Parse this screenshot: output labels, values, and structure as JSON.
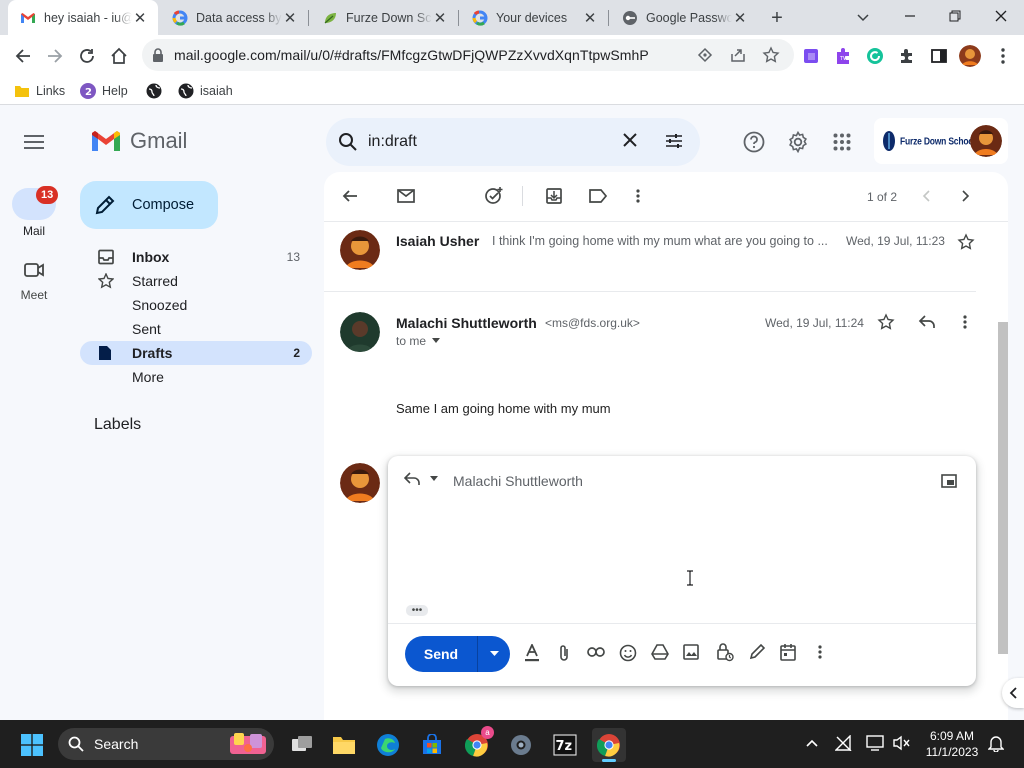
{
  "browser": {
    "tabs": [
      {
        "title": "hey isaiah - iu@"
      },
      {
        "title": "Data access by"
      },
      {
        "title": "Furze Down Sc"
      },
      {
        "title": "Your devices"
      },
      {
        "title": "Google Passwo"
      }
    ],
    "url": "mail.google.com/mail/u/0/#drafts/FMfcgzGtwDFjQWPZzXvvdXqnTtpwSmhP",
    "bookmarks": [
      {
        "label": "Links"
      },
      {
        "label": "Help"
      },
      {
        "label": ""
      },
      {
        "label": "isaiah"
      }
    ]
  },
  "gmail": {
    "logo_text": "Gmail",
    "search_value": "in:draft",
    "rail": {
      "mail_label": "Mail",
      "mail_badge": "13",
      "meet_label": "Meet"
    },
    "compose_label": "Compose",
    "nav": [
      {
        "label": "Inbox",
        "count": "13"
      },
      {
        "label": "Starred",
        "count": ""
      },
      {
        "label": "Snoozed",
        "count": ""
      },
      {
        "label": "Sent",
        "count": ""
      },
      {
        "label": "Drafts",
        "count": "2"
      },
      {
        "label": "More",
        "count": ""
      }
    ],
    "labels_heading": "Labels",
    "account_org": "Furze Down School",
    "pagination": "1 of 2",
    "collapsed_message": {
      "sender": "Isaiah Usher",
      "snippet": "I think I'm going home with my mum what are you going to ...",
      "date": "Wed, 19 Jul, 11:23"
    },
    "message": {
      "sender": "Malachi Shuttleworth",
      "email": "<ms@fds.org.uk>",
      "to": "to me",
      "date": "Wed, 19 Jul, 11:24",
      "body": "Same I am going home with my mum"
    },
    "reply": {
      "recipient": "Malachi Shuttleworth",
      "send_label": "Send"
    }
  },
  "taskbar": {
    "search_label": "Search",
    "time": "6:09 AM",
    "date": "11/1/2023",
    "chrome_badge": "a"
  },
  "colors": {
    "accent": "#0b57d0",
    "nav_selected": "#d3e3fd",
    "compose_bg": "#c2e7ff",
    "badge_red": "#d93025"
  }
}
